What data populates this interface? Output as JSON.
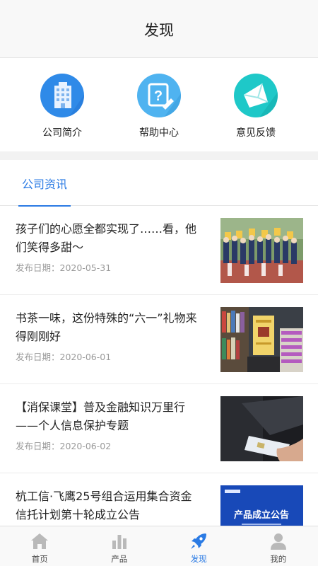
{
  "header": {
    "title": "发现"
  },
  "shortcuts": [
    {
      "label": "公司简介",
      "icon": "building-icon",
      "color": "#2f8ae8"
    },
    {
      "label": "帮助中心",
      "icon": "help-question-icon",
      "color": "#4fb3f0"
    },
    {
      "label": "意见反馈",
      "icon": "feedback-envelope-icon",
      "color": "#1ec8c8"
    }
  ],
  "tabs": {
    "active_label": "公司资讯"
  },
  "news": [
    {
      "title": "孩子们的心愿全都实现了……看，他们笑得多甜～",
      "date": "发布日期：2020-05-31"
    },
    {
      "title": "书茶一味，这份特殊的“六一”礼物来得刚刚好",
      "date": "发布日期：2020-06-01"
    },
    {
      "title": "【消保课堂】普及金融知识万里行——个人信息保护专题",
      "date": "发布日期：2020-06-02"
    },
    {
      "title": "杭工信·飞鹰25号组合运用集合资金信托计划第十轮成立公告",
      "date": ""
    }
  ],
  "thumb4_text": "产品成立公告",
  "tabbar": [
    {
      "label": "首页",
      "icon": "home-icon"
    },
    {
      "label": "产品",
      "icon": "bar-chart-icon"
    },
    {
      "label": "发现",
      "icon": "rocket-icon"
    },
    {
      "label": "我的",
      "icon": "user-icon"
    }
  ],
  "colors": {
    "accent": "#2b7be4",
    "inactive_icon": "#b9b9b9"
  }
}
